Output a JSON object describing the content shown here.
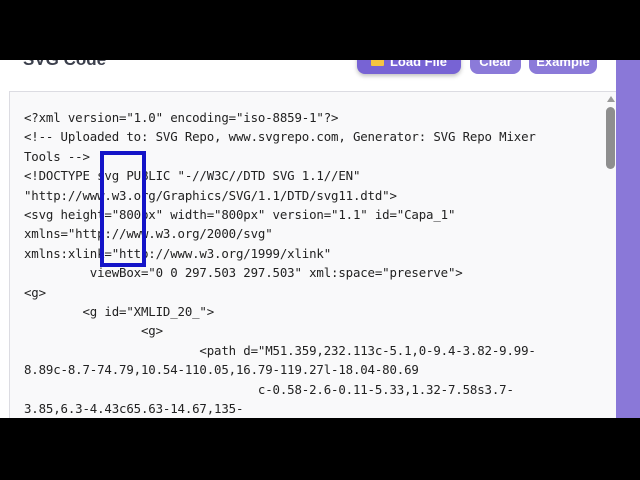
{
  "header": {
    "title": "SVG Code",
    "load_label": "Load File",
    "clear_label": "Clear",
    "example_label": "Example"
  },
  "code": {
    "lines": [
      "<?xml version=\"1.0\" encoding=\"iso-8859-1\"?>",
      "<!-- Uploaded to: SVG Repo, www.svgrepo.com, Generator: SVG Repo Mixer",
      "Tools -->",
      "<!DOCTYPE svg PUBLIC \"-//W3C//DTD SVG 1.1//EN\"",
      "\"http://www.w3.org/Graphics/SVG/1.1/DTD/svg11.dtd\">",
      "<svg height=\"800px\" width=\"800px\" version=\"1.1\" id=\"Capa_1\"",
      "xmlns=\"http://www.w3.org/2000/svg\"",
      "xmlns:xlink=\"http://www.w3.org/1999/xlink\"",
      "         viewBox=\"0 0 297.503 297.503\" xml:space=\"preserve\">",
      "<g>",
      "        <g id=\"XMLID_20_\">",
      "                <g>",
      "                        <path d=\"M51.359,232.113c-5.1,0-9.4-3.82-9.99-",
      "8.89c-8.7-74.79,10.54-110.05,16.79-119.27l-18.04-80.69",
      "                                c-0.58-2.6-0.11-5.33,1.32-7.58s3.7-",
      "3.85,6.3-4.43c65.63-14.67,135-"
    ]
  },
  "colors": {
    "accent": "#7763d4",
    "highlight": "#1414c8"
  }
}
